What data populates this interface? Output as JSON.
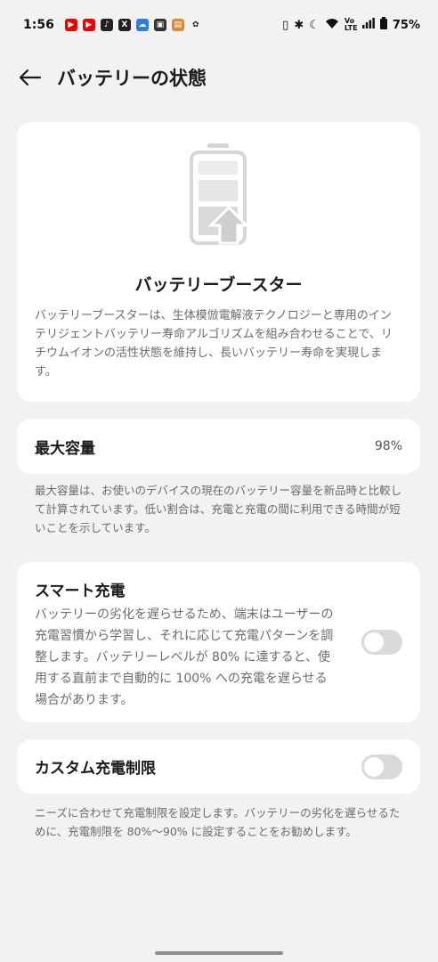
{
  "status_bar": {
    "time": "1:56",
    "battery_percent": "75%",
    "network_label": "Vo LTE",
    "app_icons": [
      "youtube-icon",
      "youtube-icon",
      "tiktok-icon",
      "x-icon",
      "cloud-icon",
      "app-icon",
      "package-icon",
      "photo-icon"
    ]
  },
  "header": {
    "title": "バッテリーの状態"
  },
  "booster": {
    "title": "バッテリーブースター",
    "description": "バッテリーブースターは、生体模倣電解液テクノロジーと専用のインテリジェントバッテリー寿命アルゴリズムを組み合わせることで、リチウムイオンの活性状態を維持し、長いバッテリー寿命を実現します。"
  },
  "capacity": {
    "label": "最大容量",
    "value": "98%",
    "note": "最大容量は、お使いのデバイスの現在のバッテリー容量を新品時と比較して計算されています。低い割合は、充電と充電の間に利用できる時間が短いことを示しています。"
  },
  "smart_charging": {
    "label": "スマート充電",
    "description": "バッテリーの劣化を遅らせるため、端末はユーザーの充電習慣から学習し、それに応じて充電パターンを調整します。バッテリーレベルが 80% に達すると、使用する直前まで自動的に 100% への充電を遅らせる場合があります。",
    "enabled": false
  },
  "custom_limit": {
    "label": "カスタム充電制限",
    "note": "ニーズに合わせて充電制限を設定します。バッテリーの劣化を遅らせるために、充電制限を 80%〜90% に設定することをお勧めします。",
    "enabled": false
  },
  "colors": {
    "background": "#f2f2f2",
    "card": "#ffffff",
    "toggle_off": "#d9d9d9",
    "secondary_text": "#6b6b6b"
  }
}
